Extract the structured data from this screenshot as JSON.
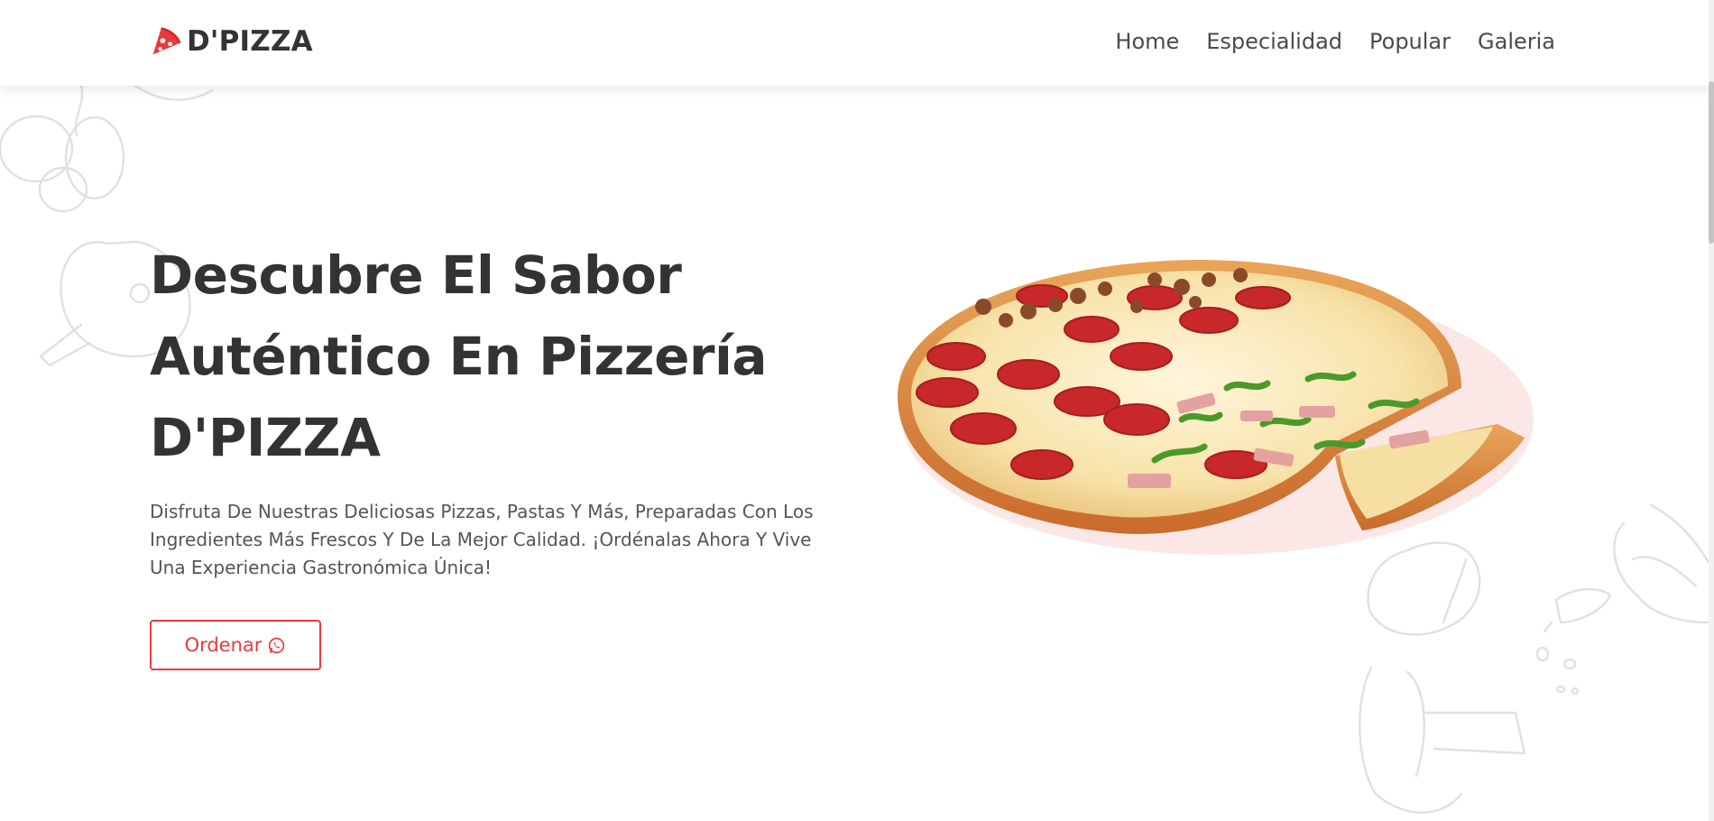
{
  "brand": {
    "name": "D'PIZZA",
    "accent": "#e63b3b"
  },
  "nav": {
    "items": [
      "Home",
      "Especialidad",
      "Popular",
      "Galeria"
    ]
  },
  "hero": {
    "title_line1": "Descubre El Sabor",
    "title_line2": "Auténtico En Pizzería",
    "title_line3": "D'PIZZA",
    "description": "Disfruta De Nuestras Deliciosas Pizzas, Pastas Y Más, Preparadas Con Los Ingredientes Más Frescos Y De La Mejor Calidad. ¡Ordénalas Ahora Y Vive Una Experiencia Gastronómica Única!",
    "cta_label": "Ordenar",
    "cta_icon": "whatsapp-icon",
    "image": "pizza-image"
  },
  "icons": {
    "logo": "pizza-slice-icon"
  }
}
